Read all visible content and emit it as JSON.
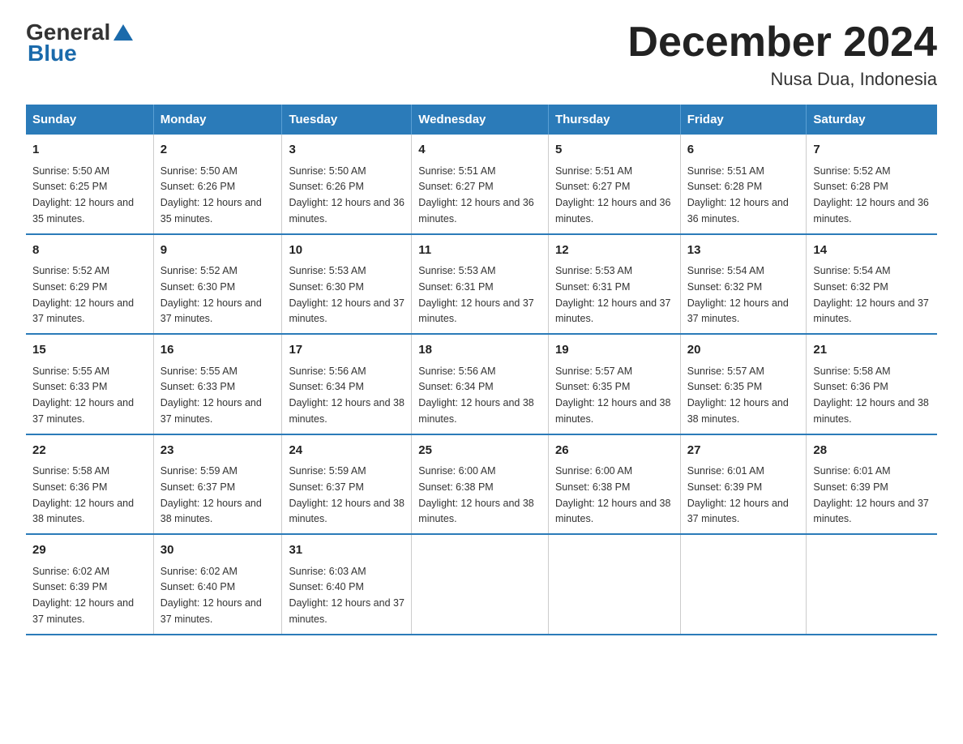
{
  "header": {
    "title": "December 2024",
    "subtitle": "Nusa Dua, Indonesia",
    "logo_general": "General",
    "logo_blue": "Blue"
  },
  "columns": [
    "Sunday",
    "Monday",
    "Tuesday",
    "Wednesday",
    "Thursday",
    "Friday",
    "Saturday"
  ],
  "weeks": [
    [
      {
        "day": "1",
        "sunrise": "5:50 AM",
        "sunset": "6:25 PM",
        "daylight": "12 hours and 35 minutes."
      },
      {
        "day": "2",
        "sunrise": "5:50 AM",
        "sunset": "6:26 PM",
        "daylight": "12 hours and 35 minutes."
      },
      {
        "day": "3",
        "sunrise": "5:50 AM",
        "sunset": "6:26 PM",
        "daylight": "12 hours and 36 minutes."
      },
      {
        "day": "4",
        "sunrise": "5:51 AM",
        "sunset": "6:27 PM",
        "daylight": "12 hours and 36 minutes."
      },
      {
        "day": "5",
        "sunrise": "5:51 AM",
        "sunset": "6:27 PM",
        "daylight": "12 hours and 36 minutes."
      },
      {
        "day": "6",
        "sunrise": "5:51 AM",
        "sunset": "6:28 PM",
        "daylight": "12 hours and 36 minutes."
      },
      {
        "day": "7",
        "sunrise": "5:52 AM",
        "sunset": "6:28 PM",
        "daylight": "12 hours and 36 minutes."
      }
    ],
    [
      {
        "day": "8",
        "sunrise": "5:52 AM",
        "sunset": "6:29 PM",
        "daylight": "12 hours and 37 minutes."
      },
      {
        "day": "9",
        "sunrise": "5:52 AM",
        "sunset": "6:30 PM",
        "daylight": "12 hours and 37 minutes."
      },
      {
        "day": "10",
        "sunrise": "5:53 AM",
        "sunset": "6:30 PM",
        "daylight": "12 hours and 37 minutes."
      },
      {
        "day": "11",
        "sunrise": "5:53 AM",
        "sunset": "6:31 PM",
        "daylight": "12 hours and 37 minutes."
      },
      {
        "day": "12",
        "sunrise": "5:53 AM",
        "sunset": "6:31 PM",
        "daylight": "12 hours and 37 minutes."
      },
      {
        "day": "13",
        "sunrise": "5:54 AM",
        "sunset": "6:32 PM",
        "daylight": "12 hours and 37 minutes."
      },
      {
        "day": "14",
        "sunrise": "5:54 AM",
        "sunset": "6:32 PM",
        "daylight": "12 hours and 37 minutes."
      }
    ],
    [
      {
        "day": "15",
        "sunrise": "5:55 AM",
        "sunset": "6:33 PM",
        "daylight": "12 hours and 37 minutes."
      },
      {
        "day": "16",
        "sunrise": "5:55 AM",
        "sunset": "6:33 PM",
        "daylight": "12 hours and 37 minutes."
      },
      {
        "day": "17",
        "sunrise": "5:56 AM",
        "sunset": "6:34 PM",
        "daylight": "12 hours and 38 minutes."
      },
      {
        "day": "18",
        "sunrise": "5:56 AM",
        "sunset": "6:34 PM",
        "daylight": "12 hours and 38 minutes."
      },
      {
        "day": "19",
        "sunrise": "5:57 AM",
        "sunset": "6:35 PM",
        "daylight": "12 hours and 38 minutes."
      },
      {
        "day": "20",
        "sunrise": "5:57 AM",
        "sunset": "6:35 PM",
        "daylight": "12 hours and 38 minutes."
      },
      {
        "day": "21",
        "sunrise": "5:58 AM",
        "sunset": "6:36 PM",
        "daylight": "12 hours and 38 minutes."
      }
    ],
    [
      {
        "day": "22",
        "sunrise": "5:58 AM",
        "sunset": "6:36 PM",
        "daylight": "12 hours and 38 minutes."
      },
      {
        "day": "23",
        "sunrise": "5:59 AM",
        "sunset": "6:37 PM",
        "daylight": "12 hours and 38 minutes."
      },
      {
        "day": "24",
        "sunrise": "5:59 AM",
        "sunset": "6:37 PM",
        "daylight": "12 hours and 38 minutes."
      },
      {
        "day": "25",
        "sunrise": "6:00 AM",
        "sunset": "6:38 PM",
        "daylight": "12 hours and 38 minutes."
      },
      {
        "day": "26",
        "sunrise": "6:00 AM",
        "sunset": "6:38 PM",
        "daylight": "12 hours and 38 minutes."
      },
      {
        "day": "27",
        "sunrise": "6:01 AM",
        "sunset": "6:39 PM",
        "daylight": "12 hours and 37 minutes."
      },
      {
        "day": "28",
        "sunrise": "6:01 AM",
        "sunset": "6:39 PM",
        "daylight": "12 hours and 37 minutes."
      }
    ],
    [
      {
        "day": "29",
        "sunrise": "6:02 AM",
        "sunset": "6:39 PM",
        "daylight": "12 hours and 37 minutes."
      },
      {
        "day": "30",
        "sunrise": "6:02 AM",
        "sunset": "6:40 PM",
        "daylight": "12 hours and 37 minutes."
      },
      {
        "day": "31",
        "sunrise": "6:03 AM",
        "sunset": "6:40 PM",
        "daylight": "12 hours and 37 minutes."
      },
      null,
      null,
      null,
      null
    ]
  ]
}
